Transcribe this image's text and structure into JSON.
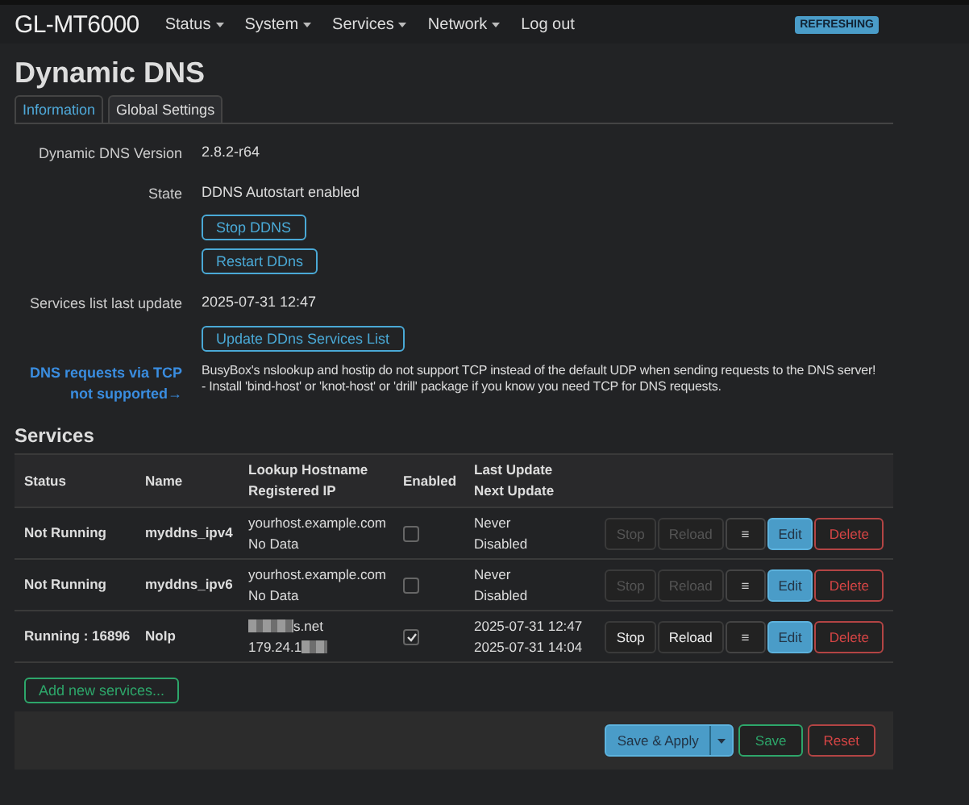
{
  "navbar": {
    "brand": "GL-MT6000",
    "menus": [
      {
        "label": "Status",
        "dropdown": true
      },
      {
        "label": "System",
        "dropdown": true
      },
      {
        "label": "Services",
        "dropdown": true
      },
      {
        "label": "Network",
        "dropdown": true
      },
      {
        "label": "Log out",
        "dropdown": false
      }
    ],
    "badge": "REFRESHING"
  },
  "title": "Dynamic DNS",
  "tabs": [
    {
      "label": "Information",
      "selected": true
    },
    {
      "label": "Global Settings",
      "selected": false
    }
  ],
  "info": [
    {
      "kind": "text",
      "label": "Dynamic DNS Version",
      "value": "2.8.2-r64"
    },
    {
      "kind": "text",
      "label": "State",
      "value": "DDNS Autostart enabled"
    },
    {
      "kind": "button",
      "label": "Stop DDNS"
    },
    {
      "kind": "button",
      "label": "Restart DDns"
    },
    {
      "kind": "text",
      "label": "Services list last update",
      "value": "2025-07-31 12:47"
    },
    {
      "kind": "button",
      "label": "Update DDns Services List"
    },
    {
      "kind": "warning",
      "label": "DNS requests via TCP not supported→",
      "lines": [
        "BusyBox's nslookup and hostip do not support TCP instead of the default UDP when sending requests to the DNS server!",
        "- Install 'bind-host' or 'knot-host' or 'drill' package if you know you need TCP for DNS requests."
      ]
    }
  ],
  "services": {
    "title": "Services",
    "columns": [
      "Status",
      "Name",
      [
        "Lookup Hostname",
        "Registered IP"
      ],
      "Enabled",
      [
        "Last Update",
        "Next Update"
      ]
    ],
    "rows": [
      {
        "status": "Not Running",
        "name": "myddns_ipv4",
        "buttons": [
          "Stop",
          "Reload",
          "≡",
          "Edit",
          "Delete"
        ],
        "hostname": "yourhost.example.com",
        "hostname_redacted": false,
        "ip": "No Data",
        "ip_redacted": false,
        "enabled": false,
        "last_update": "Never",
        "next_update": "Disabled",
        "running": false
      },
      {
        "status": "Not Running",
        "name": "myddns_ipv6",
        "buttons": [
          "Stop",
          "Reload",
          "≡",
          "Edit",
          "Delete"
        ],
        "hostname": "yourhost.example.com",
        "hostname_redacted": false,
        "ip": "No Data",
        "ip_redacted": false,
        "enabled": false,
        "last_update": "Never",
        "next_update": "Disabled",
        "running": false
      },
      {
        "status": "Running : 16896",
        "name": "NoIp",
        "buttons": [
          "Stop",
          "Reload",
          "≡",
          "Edit",
          "Delete"
        ],
        "hostname": "s.net",
        "hostname_redacted": true,
        "ip": "179.24.1",
        "ip_redacted": true,
        "enabled": true,
        "last_update": "2025-07-31 12:47",
        "next_update": "2025-07-31 14:04",
        "running": true
      }
    ],
    "add_button": "Add new services..."
  },
  "footer": {
    "save_apply": "Save & Apply",
    "save": "Save",
    "reset": "Reset"
  }
}
